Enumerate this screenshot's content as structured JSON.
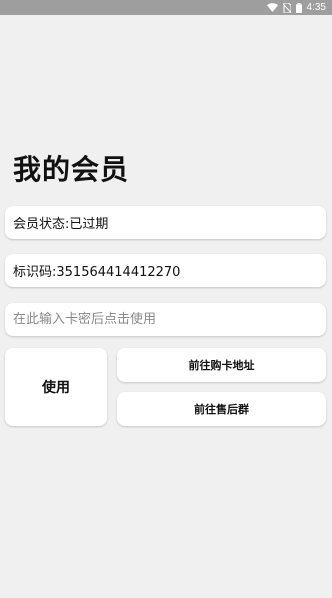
{
  "status_bar": {
    "time": "4:35",
    "icons": [
      "wifi-icon",
      "no-sim-icon",
      "battery-icon"
    ]
  },
  "page_title": "我的会员",
  "member_status": {
    "text": "会员状态:已过期"
  },
  "identifier": {
    "text": "标识码:351564414412270"
  },
  "card_key_input": {
    "value": "",
    "placeholder": "在此输入卡密后点击使用"
  },
  "buttons": {
    "use_label": "使用",
    "buy_card_label": "前往购卡地址",
    "support_group_label": "前往售后群"
  },
  "colors": {
    "background": "#f0f0f0",
    "status_bar": "#9e9e9e",
    "card": "#ffffff",
    "text": "#111111",
    "placeholder": "#8a8a8a"
  }
}
